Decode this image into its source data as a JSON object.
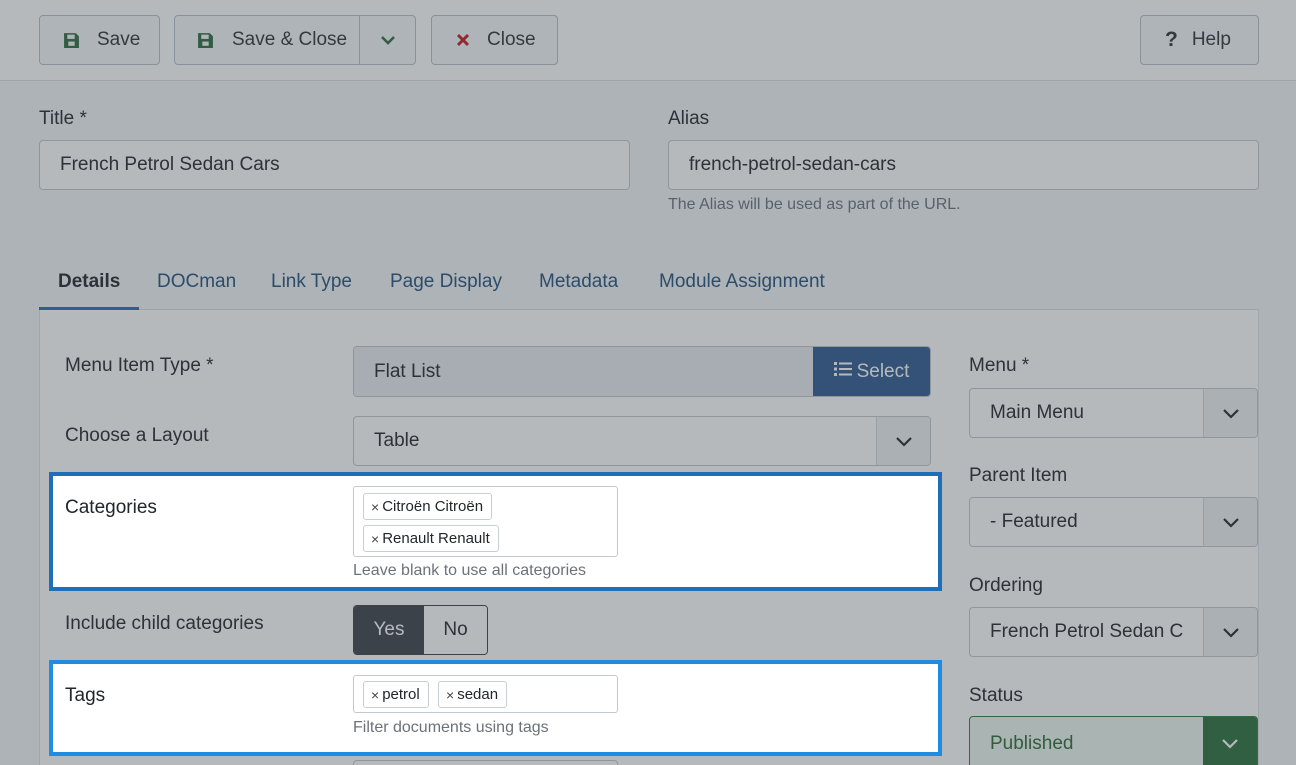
{
  "toolbar": {
    "save": "Save",
    "save_close": "Save & Close",
    "close": "Close",
    "help": "Help"
  },
  "title_field": {
    "label": "Title *",
    "value": "French Petrol Sedan Cars"
  },
  "alias_field": {
    "label": "Alias",
    "value": "french-petrol-sedan-cars",
    "hint": "The Alias will be used as part of the URL."
  },
  "tabs": [
    "Details",
    "DOCman",
    "Link Type",
    "Page Display",
    "Metadata",
    "Module Assignment"
  ],
  "details": {
    "menu_item_type": {
      "label": "Menu Item Type *",
      "value": "Flat List",
      "button": "Select"
    },
    "layout": {
      "label": "Choose a Layout",
      "value": "Table"
    },
    "categories": {
      "label": "Categories",
      "chips": [
        "Citroën Citroën",
        "Renault Renault"
      ],
      "hint": "Leave blank to use all categories"
    },
    "include_child": {
      "label": "Include child categories",
      "yes": "Yes",
      "no": "No",
      "selected": "Yes"
    },
    "tags": {
      "label": "Tags",
      "chips": [
        "petrol",
        "sedan"
      ],
      "hint": "Filter documents using tags"
    }
  },
  "sidebar": {
    "menu": {
      "label": "Menu *",
      "value": "Main Menu"
    },
    "parent": {
      "label": "Parent Item",
      "value": "- Featured"
    },
    "ordering": {
      "label": "Ordering",
      "value": "French Petrol Sedan Cars"
    },
    "status": {
      "label": "Status",
      "value": "Published"
    }
  },
  "chip_remove_glyph": "×",
  "colors": {
    "select_button": "#2f5a90",
    "highlight": "#1f6fb8",
    "status_green": "#2b6e3a"
  }
}
